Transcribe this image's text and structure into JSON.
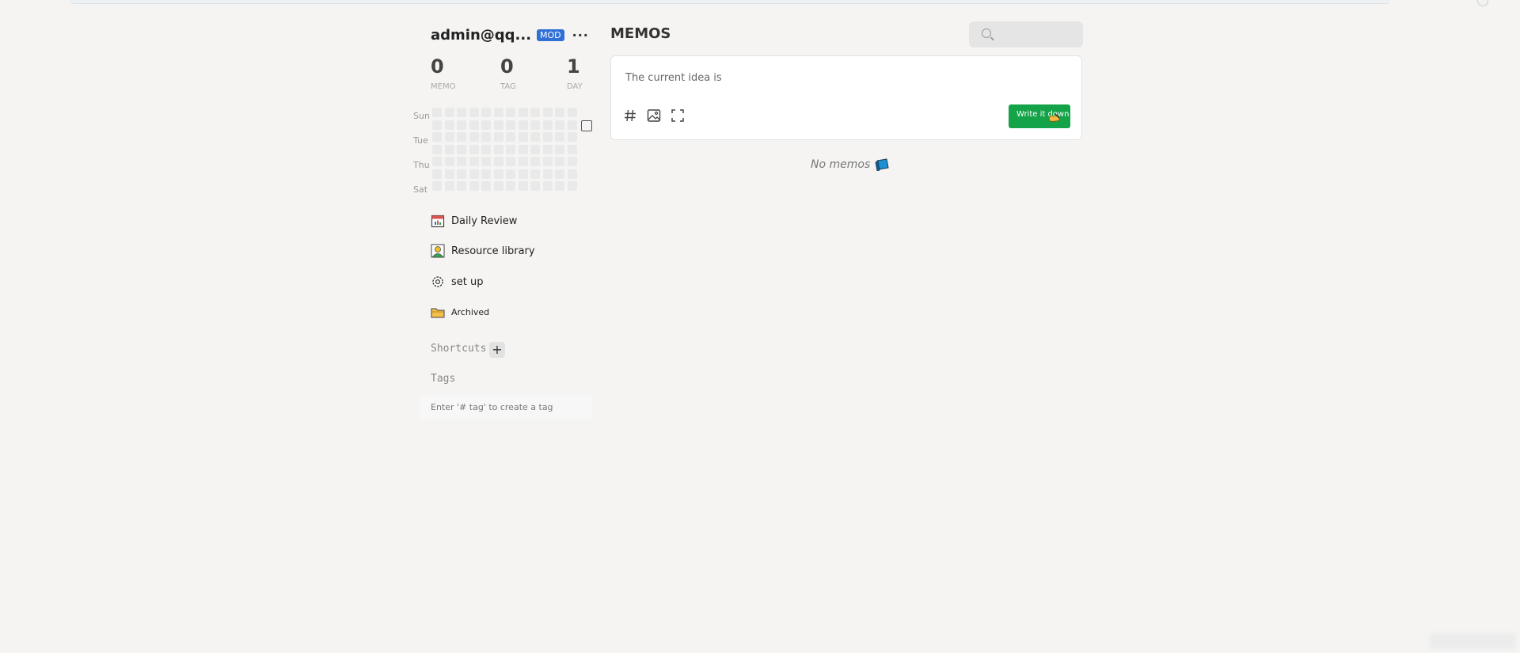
{
  "user": {
    "name": "admin@qq....",
    "badge": "MOD",
    "more_label": "···"
  },
  "stats": [
    {
      "value": "0",
      "label": "MEMO"
    },
    {
      "value": "0",
      "label": "TAG"
    },
    {
      "value": "1",
      "label": "DAY"
    }
  ],
  "heatmap": {
    "day_labels": [
      "Sun",
      "Tue",
      "Thu",
      "Sat"
    ]
  },
  "nav": [
    {
      "label": "Daily Review",
      "icon": "calendar-icon"
    },
    {
      "label": "Resource library",
      "icon": "person-icon"
    },
    {
      "label": "set up",
      "icon": "gear-icon"
    },
    {
      "label": "Archived",
      "icon": "folder-icon"
    }
  ],
  "shortcuts": {
    "title": "Shortcuts",
    "add_label": "+"
  },
  "tags": {
    "title": "Tags",
    "hint": "Enter '# tag' to create a tag"
  },
  "main": {
    "title": "MEMOS",
    "search_placeholder": "",
    "editor_placeholder": "The current idea is",
    "write_button": "Write it down",
    "empty_text": "No memos"
  },
  "colors": {
    "accent_green": "#15a34a",
    "badge_blue": "#2f6fd6",
    "background": "#f5f4f2"
  }
}
